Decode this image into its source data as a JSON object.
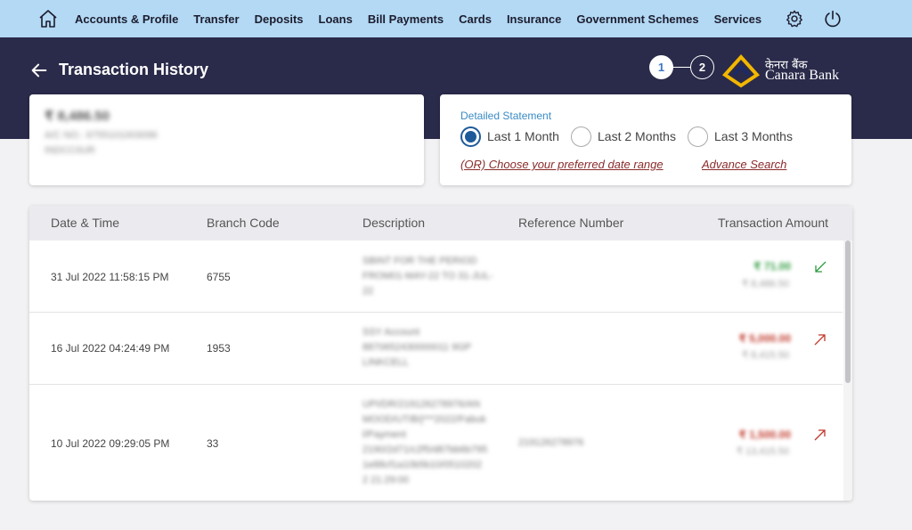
{
  "nav": {
    "items": [
      "Accounts & Profile",
      "Transfer",
      "Deposits",
      "Loans",
      "Bill Payments",
      "Cards",
      "Insurance",
      "Government Schemes",
      "Services"
    ]
  },
  "header": {
    "title": "Transaction History",
    "steps": [
      "1",
      "2"
    ],
    "logo_hindi": "केनरा बैंक",
    "logo_en": "Canara Bank"
  },
  "account": {
    "balance": "₹ 8,486.50",
    "number": "A/C NO.: 6755101003096",
    "ifsc": "INDCC0UR"
  },
  "filter": {
    "heading": "Detailed Statement",
    "options": [
      "Last 1 Month",
      "Last 2 Months",
      "Last 3 Months"
    ],
    "selected": "Last 1 Month",
    "date_range_link": "(OR) Choose your preferred date range",
    "advance_search_link": "Advance Search"
  },
  "table": {
    "columns": [
      "Date & Time",
      "Branch Code",
      "Description",
      "Reference Number",
      "Transaction Amount"
    ],
    "rows": [
      {
        "date": "31 Jul 2022 11:58:15 PM",
        "branch": "6755",
        "description": [
          "SBINT FOR THE PERIOD",
          "FROM01-MAY-22 TO 31-JUL-",
          "22"
        ],
        "reference": "",
        "amount": "₹ 71.00",
        "balance": "₹ 8,486.50",
        "direction": "credit"
      },
      {
        "date": "16 Jul 2022 04:24:49 PM",
        "branch": "1953",
        "description": [
          "SSY Account",
          "8870652430000011 9GP",
          "LINKCELL"
        ],
        "reference": "",
        "amount": "₹ 5,000.00",
        "balance": "₹ 8,415.50",
        "direction": "debit"
      },
      {
        "date": "10 Jul 2022 09:29:05 PM",
        "branch": "33",
        "description": [
          "UPI/DR/219126278976/AN",
          "MOOD/UTIB/j***2022/Fabuk",
          "l/Payment",
          "2190/2d71/c2f5/d87bb6b795",
          "1e88cf1a10b5b10/0510202",
          "2 21:29:00"
        ],
        "reference": "219126278976",
        "amount": "₹ 1,500.00",
        "balance": "₹ 13,415.50",
        "direction": "debit"
      }
    ]
  },
  "colors": {
    "nav_bg": "#b3d9f4",
    "header_bg": "#2a2a4a",
    "credit": "#2e9b3f",
    "debit": "#c0392b",
    "radio_selected": "#1e5a99",
    "link": "#8a2b2b",
    "logo_accent": "#f2b700"
  },
  "icons": {
    "home": "home-icon",
    "settings": "gear-icon",
    "power": "power-icon",
    "back": "arrow-left-icon",
    "credit": "arrow-down-left-icon",
    "debit": "arrow-up-right-icon"
  }
}
